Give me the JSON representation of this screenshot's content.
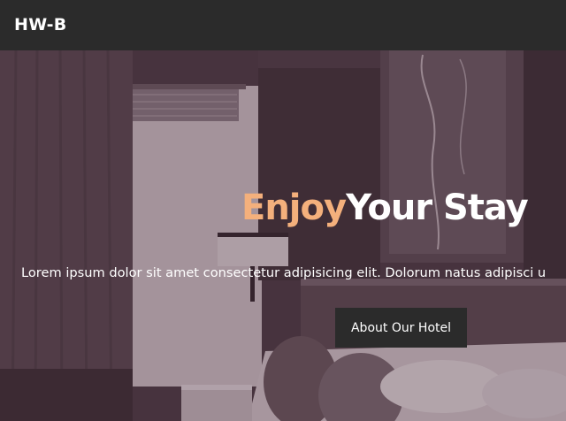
{
  "navbar": {
    "brand": "HW-B"
  },
  "hero": {
    "title_accent": "Enjoy",
    "title_rest": "Your Stay",
    "lead": "Lorem ipsum dolor sit amet consectetur adipisicing elit. Dolorum natus adipisci u",
    "cta_label": "About Our Hotel"
  }
}
